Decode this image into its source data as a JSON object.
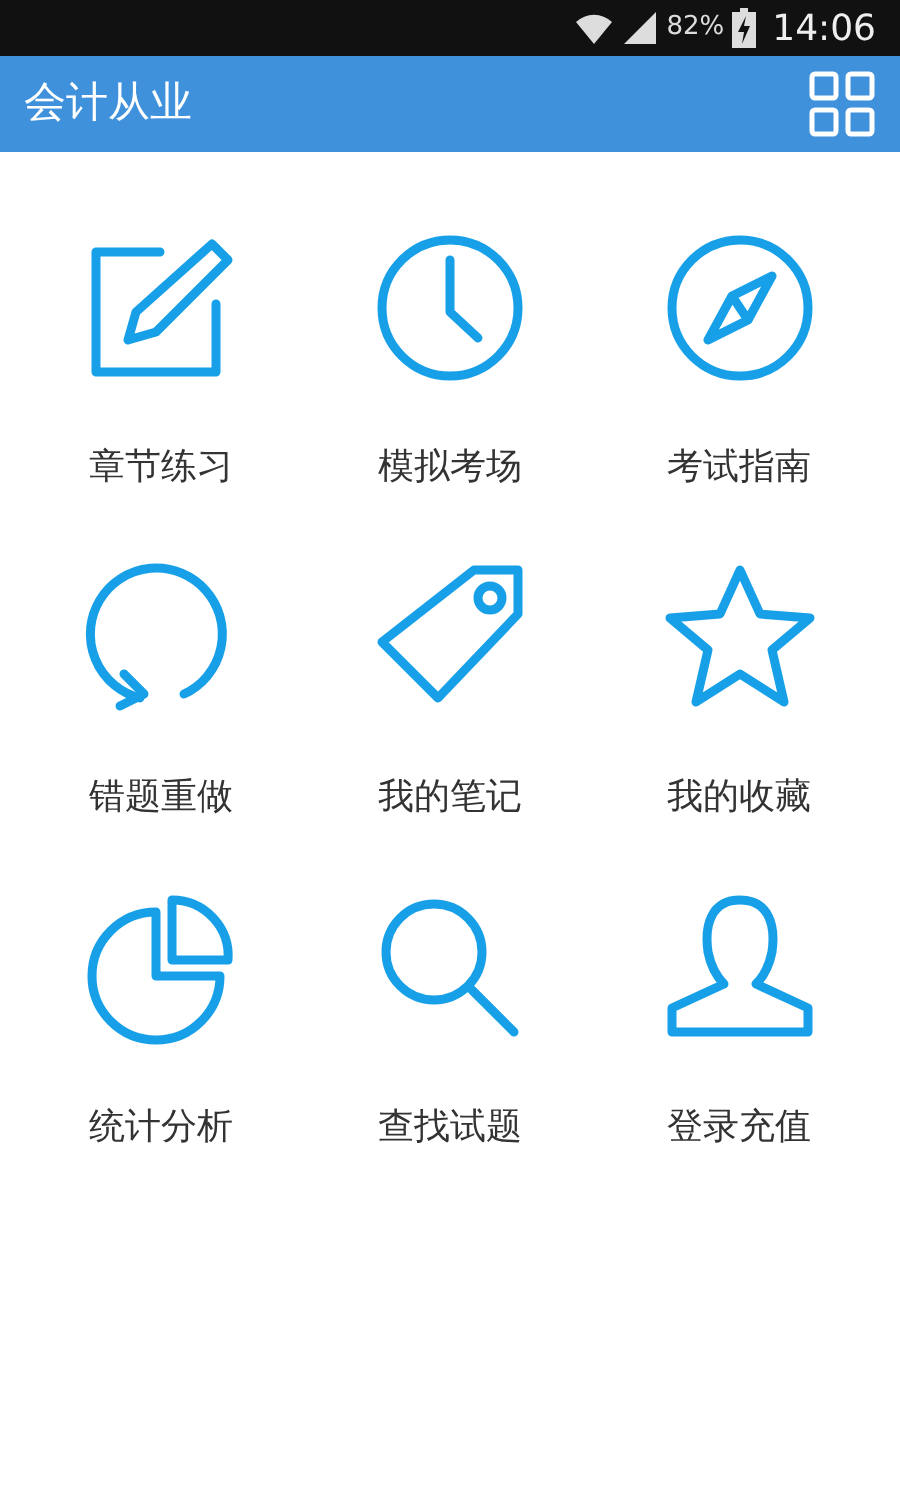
{
  "status_bar": {
    "battery": "82%",
    "time": "14:06"
  },
  "app_bar": {
    "title": "会计从业"
  },
  "menu_items": [
    {
      "label": "章节练习"
    },
    {
      "label": "模拟考场"
    },
    {
      "label": "考试指南"
    },
    {
      "label": "错题重做"
    },
    {
      "label": "我的笔记"
    },
    {
      "label": "我的收藏"
    },
    {
      "label": "统计分析"
    },
    {
      "label": "查找试题"
    },
    {
      "label": "登录充值"
    }
  ]
}
